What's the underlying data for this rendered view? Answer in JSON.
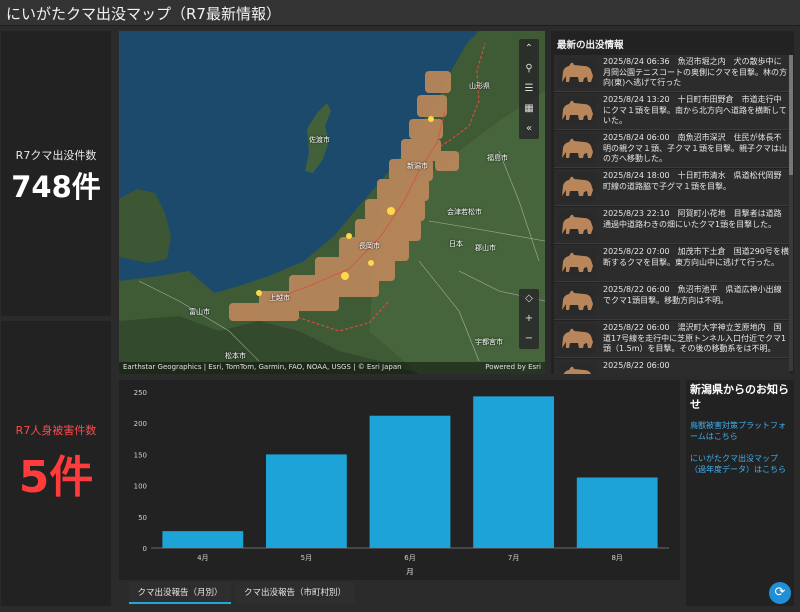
{
  "header": {
    "title": "にいがたクマ出没マップ（R7最新情報）"
  },
  "kpi_count": {
    "label": "R7クマ出没件数",
    "value": "748件"
  },
  "kpi_injury": {
    "label": "R7人身被害件数",
    "value": "5件"
  },
  "map": {
    "attribution": "Earthstar Geographics | Esri, TomTom, Garmin, FAO, NOAA, USGS | © Esri Japan",
    "powered_by": "Powered by Esri",
    "places": [
      "山形県",
      "新潟市",
      "佐渡市",
      "日本",
      "長岡市",
      "富山市",
      "松本市",
      "上越市",
      "宇都宮市",
      "福島市",
      "郡山市",
      "会津若松市"
    ],
    "tools": [
      "expand-icon",
      "search-icon",
      "list-icon",
      "layers-icon",
      "collapse-icon"
    ],
    "tools2": [
      "locate-icon",
      "zoom-in-icon",
      "zoom-out-icon"
    ],
    "colors": {
      "sea": "#1c4a6c",
      "land": "#3e5a35",
      "bear": "#b8865a"
    }
  },
  "feed": {
    "title": "最新の出没情報",
    "items": [
      {
        "text": "2025/8/24 06:36　魚沼市堀之内　犬の散歩中に月岡公園テニスコートの奥側にクマを目撃。林の方向(東)へ逃げて行った"
      },
      {
        "text": "2025/8/24 13:20　十日町市田野倉　市道走行中にクマ１頭を目撃。南から北方向へ道路を横断していた。"
      },
      {
        "text": "2025/8/24 06:00　南魚沼市深沢　住民が体長不明の親クマ１頭、子クマ１頭を目撃。親子クマは山の方へ移動した。"
      },
      {
        "text": "2025/8/24 18:00　十日町市清水　県道松代岡野町線の道路脇で子グマ１頭を目撃。"
      },
      {
        "text": "2025/8/23 22:10　阿賀町小花地　目撃者は道路通過中道路わきの畑にいたクマ1頭を目撃した。"
      },
      {
        "text": "2025/8/22 07:00　加茂市下土倉　国道290号を横断するクマを目撃。東方向山中に逃げて行った。"
      },
      {
        "text": "2025/8/22 06:00　魚沼市池平　県道広神小出線でクマ1頭目撃。移動方向は不明。"
      },
      {
        "text": "2025/8/22 06:00　湯沢町大字神立芝原地内　国道17号線を走行中に芝原トンネル入口付近でクマ1頭（1.5m）を目撃。その後の移動系をは不明。"
      },
      {
        "text": "2025/8/22 06:00"
      }
    ]
  },
  "chart_data": {
    "type": "bar",
    "categories": [
      "4月",
      "5月",
      "6月",
      "7月",
      "8月"
    ],
    "values": [
      27,
      150,
      212,
      243,
      113
    ],
    "xlabel": "月",
    "ylabel": "",
    "ylim": [
      0,
      250
    ],
    "yticks": [
      "0",
      "50",
      "100",
      "150",
      "200",
      "250"
    ],
    "grid": false,
    "bar_color": "#1ea3d8"
  },
  "tabs": [
    {
      "label": "クマ出没報告（月別）",
      "active": true
    },
    {
      "label": "クマ出没報告（市町村別）",
      "active": false
    }
  ],
  "notice": {
    "title": "新潟県からのお知らせ",
    "links": [
      "鳥獣被害対策プラットフォームはこちら",
      "にいがたクマ出没マップ（過年度データ）はこちら"
    ]
  }
}
